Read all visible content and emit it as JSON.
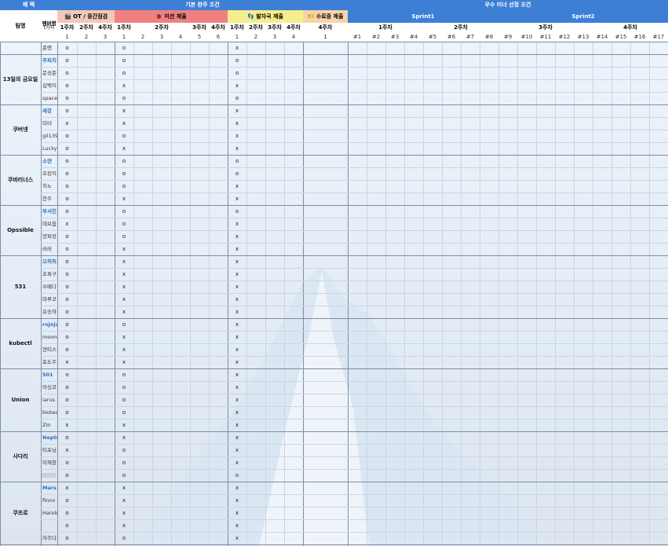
{
  "headers": {
    "benefit": "혜 택",
    "basic": "기본 완주 조건",
    "excellent": "우수 러너 선정 조건",
    "team": "팀명",
    "member": "멤버명",
    "member_sub": "(가치",
    "ot": "🎬 OT / 중간점검",
    "mission": "🐞 미션 제출",
    "report": "👣 발자국 제출",
    "cert": "🎫 수료증 제출",
    "sprint1": "Sprint1",
    "sprint2": "Sprint2"
  },
  "week_labels": [
    "1주차",
    "2주차",
    "4주차",
    "1주차",
    "2주차",
    "3주차",
    "4주차",
    "1주차",
    "2주차",
    "3주차",
    "4주차",
    "4주차",
    "1주차",
    "2주차",
    "3주차",
    "4주차"
  ],
  "sub_labels": [
    "1",
    "2",
    "3",
    "1",
    "2",
    "3",
    "4",
    "5",
    "6",
    "1",
    "2",
    "3",
    "4",
    "1",
    "#1",
    "#2",
    "#3",
    "#4",
    "#5",
    "#6",
    "#7",
    "#8",
    "#9",
    "#10",
    "#11",
    "#12",
    "#13",
    "#14",
    "#15",
    "#16",
    "#17"
  ],
  "icons": [
    "clapper-icon",
    "bug-icon",
    "footprints-icon",
    "ticket-icon"
  ],
  "teams": [
    {
      "name": "",
      "members": [
        {
          "name": "준맨",
          "lead": false,
          "ot": "o",
          "mission": "o",
          "report": "x"
        }
      ]
    },
    {
      "name": "13일의 금요일",
      "members": [
        {
          "name": "주피치",
          "lead": true,
          "ot": "o",
          "mission": "o",
          "report": "o"
        },
        {
          "name": "문성준",
          "lead": false,
          "ot": "o",
          "mission": "o",
          "report": "o"
        },
        {
          "name": "김백이",
          "lead": false,
          "ot": "o",
          "mission": "x",
          "report": "x"
        },
        {
          "name": "spacei",
          "lead": false,
          "ot": "o",
          "mission": "o",
          "report": "o"
        }
      ]
    },
    {
      "name": "쿠버넷",
      "members": [
        {
          "name": "세강",
          "lead": true,
          "ot": "o",
          "mission": "x",
          "report": "x"
        },
        {
          "name": "미터",
          "lead": false,
          "ot": "x",
          "mission": "x",
          "report": "x"
        },
        {
          "name": "gil139",
          "lead": false,
          "ot": "o",
          "mission": "o",
          "report": "x"
        },
        {
          "name": "Lucky",
          "lead": false,
          "ot": "o",
          "mission": "x",
          "report": "x"
        }
      ]
    },
    {
      "name": "쿠바러너스",
      "members": [
        {
          "name": "소연",
          "lead": true,
          "ot": "o",
          "mission": "o",
          "report": "o"
        },
        {
          "name": "호킹이",
          "lead": false,
          "ot": "o",
          "mission": "o",
          "report": "o"
        },
        {
          "name": "히노",
          "lead": false,
          "ot": "o",
          "mission": "o",
          "report": "x"
        },
        {
          "name": "찬주",
          "lead": false,
          "ot": "o",
          "mission": "x",
          "report": "x"
        }
      ]
    },
    {
      "name": "Opssible",
      "members": [
        {
          "name": "부서진",
          "lead": true,
          "ot": "o",
          "mission": "o",
          "report": "o"
        },
        {
          "name": "데브옵",
          "lead": false,
          "ot": "x",
          "mission": "o",
          "report": "x"
        },
        {
          "name": "양파장",
          "lead": false,
          "ot": "o",
          "mission": "o",
          "report": "x"
        },
        {
          "name": "러러",
          "lead": false,
          "ot": "o",
          "mission": "x",
          "report": "x"
        }
      ]
    },
    {
      "name": "531",
      "members": [
        {
          "name": "으허허",
          "lead": true,
          "ot": "o",
          "mission": "x",
          "report": "x"
        },
        {
          "name": "초록구",
          "lead": false,
          "ot": "o",
          "mission": "x",
          "report": "x"
        },
        {
          "name": "수배다",
          "lead": false,
          "ot": "o",
          "mission": "x",
          "report": "x"
        },
        {
          "name": "마루코",
          "lead": false,
          "ot": "o",
          "mission": "x",
          "report": "x"
        },
        {
          "name": "유승하",
          "lead": false,
          "ot": "o",
          "mission": "x",
          "report": "x"
        }
      ]
    },
    {
      "name": "kubectl",
      "members": [
        {
          "name": "rojoju",
          "lead": true,
          "ot": "o",
          "mission": "o",
          "report": "x"
        },
        {
          "name": "moone",
          "lead": false,
          "ot": "o",
          "mission": "x",
          "report": "x"
        },
        {
          "name": "연티스",
          "lead": false,
          "ot": "o",
          "mission": "x",
          "report": "x"
        },
        {
          "name": "포도주",
          "lead": false,
          "ot": "x",
          "mission": "x",
          "report": "x"
        }
      ]
    },
    {
      "name": "Union",
      "members": [
        {
          "name": "501",
          "lead": true,
          "ot": "o",
          "mission": "o",
          "report": "x"
        },
        {
          "name": "아싱코",
          "lead": false,
          "ot": "o",
          "mission": "o",
          "report": "x"
        },
        {
          "name": "iarus",
          "lead": false,
          "ot": "o",
          "mission": "o",
          "report": "x"
        },
        {
          "name": "bioteo",
          "lead": false,
          "ot": "o",
          "mission": "o",
          "report": "x"
        },
        {
          "name": "Zin",
          "lead": false,
          "ot": "x",
          "mission": "x",
          "report": "x"
        }
      ]
    },
    {
      "name": "사다리",
      "members": [
        {
          "name": "Neptu",
          "lead": true,
          "ot": "o",
          "mission": "x",
          "report": "x"
        },
        {
          "name": "티프닝",
          "lead": false,
          "ot": "x",
          "mission": "o",
          "report": "x"
        },
        {
          "name": "이재창",
          "lead": false,
          "ot": "o",
          "mission": "o",
          "report": "x"
        },
        {
          "name": "",
          "lead": false,
          "redacted": true,
          "ot": "o",
          "mission": "o",
          "report": "o"
        }
      ]
    },
    {
      "name": "쿠프로",
      "members": [
        {
          "name": "Mars",
          "lead": true,
          "ot": "x",
          "mission": "x",
          "report": "x"
        },
        {
          "name": "finnn",
          "lead": false,
          "ot": "o",
          "mission": "x",
          "report": "x"
        },
        {
          "name": "Harold",
          "lead": false,
          "ot": "o",
          "mission": "x",
          "report": "x"
        },
        {
          "name": "",
          "lead": false,
          "ot": "o",
          "mission": "x",
          "report": "x"
        },
        {
          "name": "자주다",
          "lead": false,
          "ot": "o",
          "mission": "o",
          "report": "x"
        }
      ]
    }
  ],
  "colors": {
    "header_blue": "#3e7fd6",
    "ot": "#f2c9b8",
    "mission": "#f08080",
    "report": "#f6ee8a",
    "cert": "#f8d3a9",
    "grid": "#c9d6e4",
    "lead_text": "#2f6fc2"
  }
}
